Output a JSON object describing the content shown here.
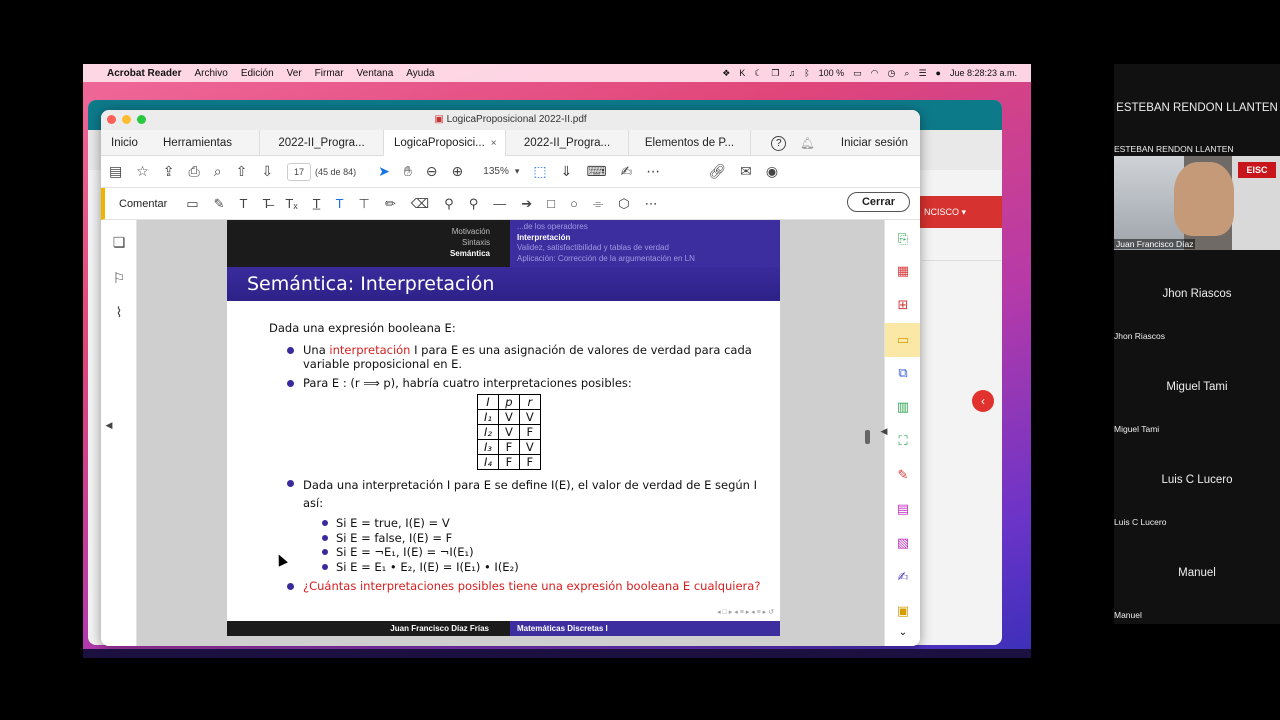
{
  "menubar": {
    "app": "Acrobat Reader",
    "items": [
      "Archivo",
      "Edición",
      "Ver",
      "Firmar",
      "Ventana",
      "Ayuda"
    ],
    "battery": "100 %",
    "clock": "Jue  8:28:23 a.m."
  },
  "window": {
    "title": "LogicaProposicional 2022-II.pdf"
  },
  "tabs": {
    "home": "Inicio",
    "tools": "Herramientas",
    "docs": [
      "2022-II_Progra...",
      "LogicaProposici...",
      "2022-II_Progra...",
      "Elementos de P..."
    ],
    "close": "×",
    "help": "?",
    "signin": "Iniciar sesión"
  },
  "toolbar": {
    "page": "17",
    "pagecount": "(45 de 84)",
    "zoom": "135%"
  },
  "comment_bar": {
    "label": "Comentar",
    "close": "Cerrar"
  },
  "background_app": {
    "user_label": "NCISCO"
  },
  "slide": {
    "nav_left": [
      "Motivación",
      "Sintaxis",
      "Semántica"
    ],
    "nav_right": [
      "...de los operadores",
      "Interpretación",
      "Validez, satisfactibilidad y tablas de verdad",
      "Aplicación: Corrección de la argumentación en LN"
    ],
    "title": "Semántica: Interpretación",
    "intro": "Dada una expresión booleana E:",
    "b1_pre": "Una ",
    "b1_red": "interpretación",
    "b1_post": " I para E es una asignación de valores de verdad para cada variable proposicional en E.",
    "b2": "Para E : (r ⟹ p), habría cuatro interpretaciones posibles:",
    "table_header": [
      "I",
      "p",
      "r"
    ],
    "table_rows": [
      [
        "I₁",
        "V",
        "V"
      ],
      [
        "I₂",
        "V",
        "F"
      ],
      [
        "I₃",
        "F",
        "V"
      ],
      [
        "I₄",
        "F",
        "F"
      ]
    ],
    "b3": "Dada una interpretación I para E se define I(E), el valor de verdad de E según I así:",
    "sub": [
      "Si E = true, I(E) = V",
      "Si E = false, I(E) = F",
      "Si E = ¬E₁, I(E) = ¬I(E₁)",
      "Si E = E₁ • E₂, I(E) = I(E₁) • I(E₂)"
    ],
    "b4": "¿Cuántas interpretaciones posibles tiene una expresión booleana E cualquiera?",
    "footer_left": "Juan Francisco Díaz Frías",
    "footer_right": "Matemáticas Discretas I"
  },
  "participants": {
    "top_name": "ESTEBAN RENDON LLANTEN",
    "video_label": "ESTEBAN RENDON LLANTEN",
    "video_tag": "Juan Francisco Díaz",
    "logo": "EISC",
    "tiles": [
      {
        "name": "Jhon Riascos",
        "tag": "Jhon Riascos"
      },
      {
        "name": "Miguel Tami",
        "tag": "Miguel Tami"
      },
      {
        "name": "Luis C Lucero",
        "tag": "Luis C Lucero"
      },
      {
        "name": "Manuel",
        "tag": "Manuel"
      }
    ]
  }
}
